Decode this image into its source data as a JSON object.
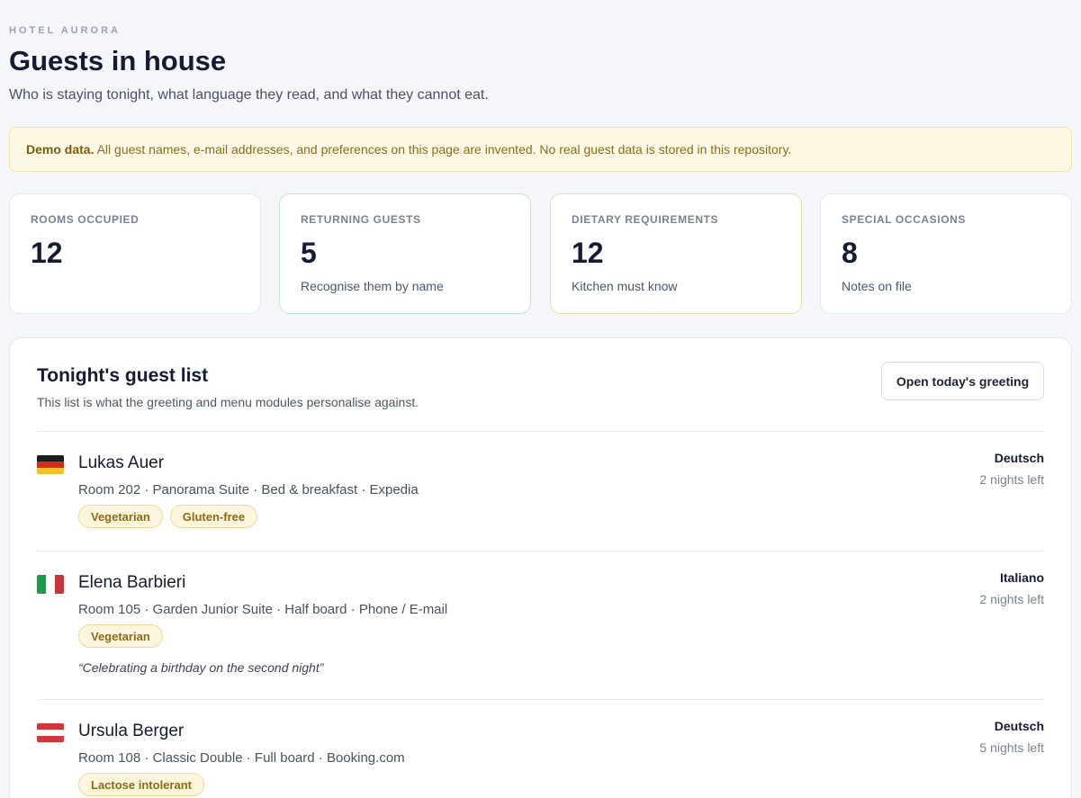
{
  "header": {
    "brand": "HOTEL AURORA",
    "title": "Guests in house",
    "subtitle": "Who is staying tonight, what language they read, and what they cannot eat."
  },
  "banner": {
    "strong": "Demo data.",
    "text": " All guest names, e-mail addresses, and preferences on this page are invented. No real guest data is stored in this repository."
  },
  "stats": [
    {
      "label": "ROOMS OCCUPIED",
      "value": "12",
      "note": ""
    },
    {
      "label": "RETURNING GUESTS",
      "value": "5",
      "note": "Recognise them by name"
    },
    {
      "label": "DIETARY REQUIREMENTS",
      "value": "12",
      "note": "Kitchen must know"
    },
    {
      "label": "SPECIAL OCCASIONS",
      "value": "8",
      "note": "Notes on file"
    }
  ],
  "guest_list": {
    "title": "Tonight's guest list",
    "subtitle": "This list is what the greeting and menu modules personalise against.",
    "button": "Open today's greeting",
    "guests": [
      {
        "name": "Lukas Auer",
        "flag_icon": "germany-flag-icon",
        "meta": "Room 202 · Panorama Suite · Bed & breakfast · Expedia",
        "tags": [
          "Vegetarian",
          "Gluten-free"
        ],
        "note": "",
        "language": "Deutsch",
        "nights": "2 nights left"
      },
      {
        "name": "Elena Barbieri",
        "flag_icon": "italy-flag-icon",
        "meta": "Room 105 · Garden Junior Suite · Half board · Phone / E-mail",
        "tags": [
          "Vegetarian"
        ],
        "note": "“Celebrating a birthday on the second night”",
        "language": "Italiano",
        "nights": "2 nights left"
      },
      {
        "name": "Ursula Berger",
        "flag_icon": "austria-flag-icon",
        "meta": "Room 108 · Classic Double · Full board · Booking.com",
        "tags": [
          "Lactose intolerant"
        ],
        "note": "",
        "language": "Deutsch",
        "nights": "5 nights left"
      }
    ]
  },
  "colors": {
    "page_bg": "#f5f6fa",
    "banner_bg": "#fdf9e5",
    "tag_bg": "#fdf6dc",
    "tag_text": "#8a6a18",
    "returning_border": "#bfe6d6",
    "dietary_border": "#f0dcaa"
  }
}
